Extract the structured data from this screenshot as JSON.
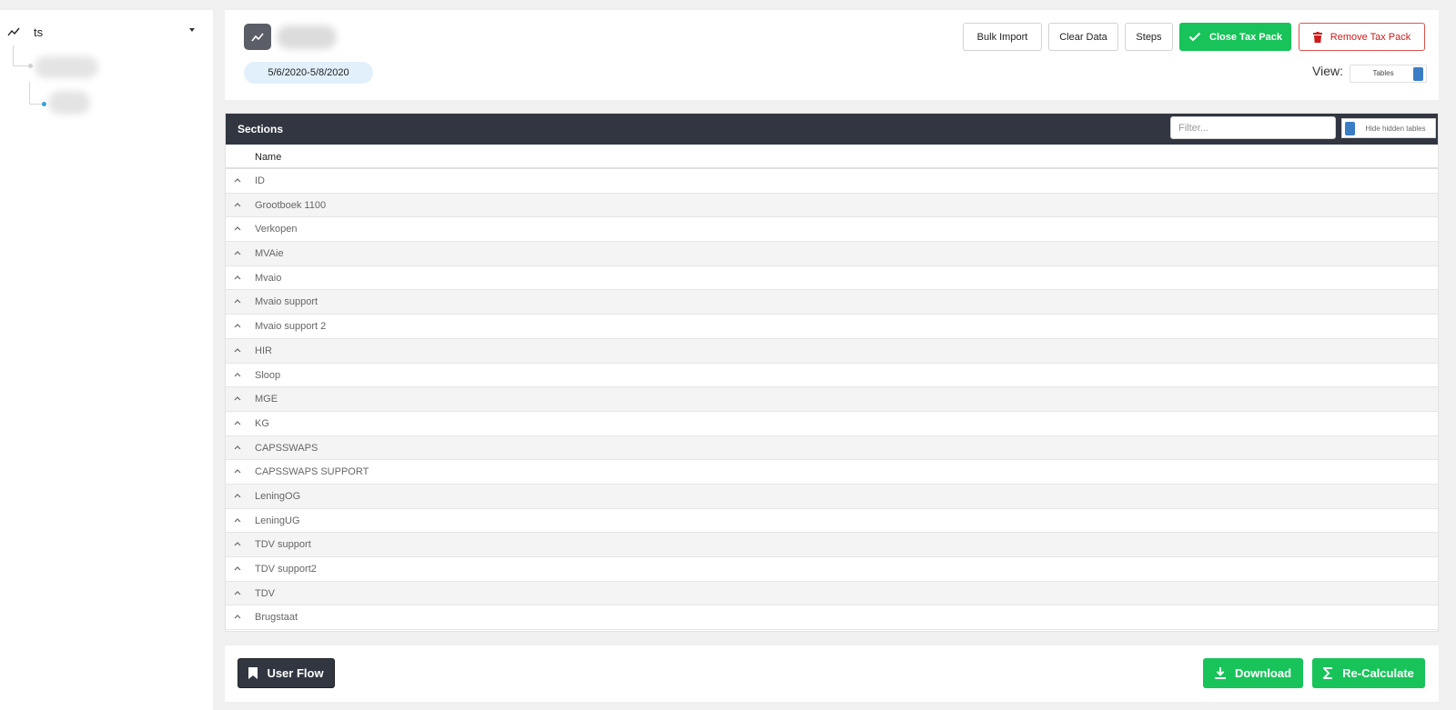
{
  "sidebar": {
    "root_label": "ts",
    "root_icon": "trending-line-icon"
  },
  "header": {
    "date_range": "5/6/2020-5/8/2020",
    "buttons": {
      "bulk_import": "Bulk Import",
      "clear_data": "Clear Data",
      "steps": "Steps",
      "close_tax_pack": "Close Tax Pack",
      "remove_tax_pack": "Remove Tax Pack"
    },
    "view_label": "View:",
    "view_toggle_text": "Tables"
  },
  "sections": {
    "title": "Sections",
    "filter_placeholder": "Filter...",
    "hidden_toggle_text": "Hide hidden tables",
    "column_name": "Name",
    "rows": [
      "ID",
      "Grootboek 1100",
      "Verkopen",
      "MVAie",
      "Mvaio",
      "Mvaio support",
      "Mvaio support 2",
      "HIR",
      "Sloop",
      "MGE",
      "KG",
      "CAPSSWAPS",
      "CAPSSWAPS SUPPORT",
      "LeningOG",
      "LeningUG",
      "TDV support",
      "TDV support2",
      "TDV",
      "Brugstaat"
    ]
  },
  "footer": {
    "user_flow": "User Flow",
    "download": "Download",
    "recalculate": "Re-Calculate"
  },
  "colors": {
    "accent_green": "#18c35a",
    "danger_red": "#cc1c1c",
    "header_dark": "#313641",
    "toggle_blue": "#3a7dc4",
    "tree_active": "#2a9bd8"
  }
}
